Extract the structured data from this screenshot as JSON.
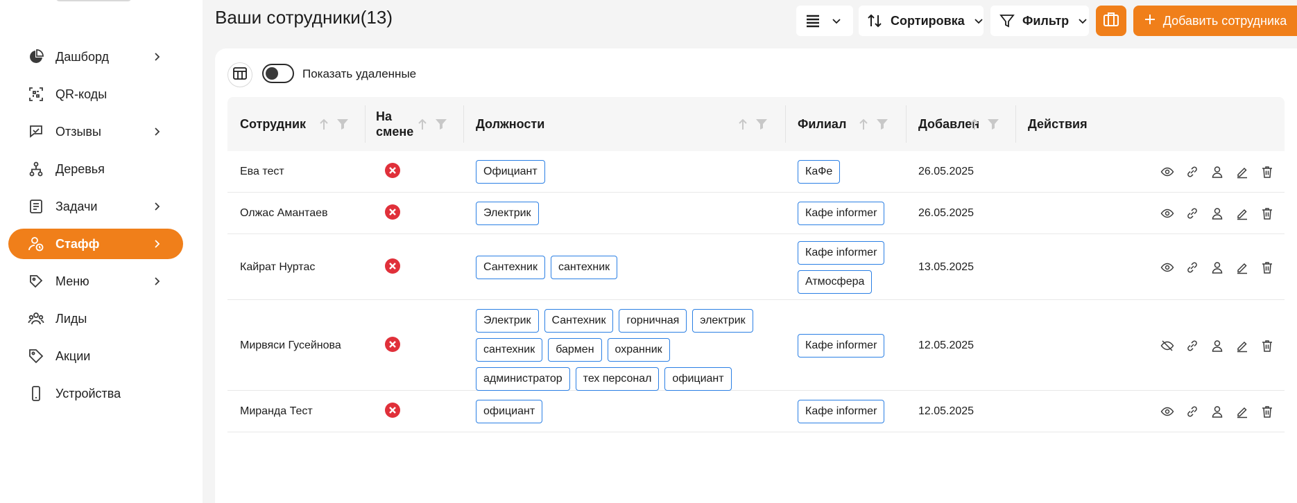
{
  "sidebar": {
    "items": [
      {
        "label": "Дашборд",
        "icon": "pie-chart-icon",
        "has_chevron": true,
        "active": false
      },
      {
        "label": "QR-коды",
        "icon": "qr-scan-icon",
        "has_chevron": false,
        "active": false
      },
      {
        "label": "Отзывы",
        "icon": "chat-check-icon",
        "has_chevron": true,
        "active": false
      },
      {
        "label": "Деревья",
        "icon": "tree-icon",
        "has_chevron": false,
        "active": false
      },
      {
        "label": "Задачи",
        "icon": "task-list-icon",
        "has_chevron": true,
        "active": false
      },
      {
        "label": "Стафф",
        "icon": "user-clock-icon",
        "has_chevron": true,
        "active": true
      },
      {
        "label": "Меню",
        "icon": "menu-tag-icon",
        "has_chevron": true,
        "active": false
      },
      {
        "label": "Лиды",
        "icon": "people-group-icon",
        "has_chevron": false,
        "active": false
      },
      {
        "label": "Акции",
        "icon": "price-tag-icon",
        "has_chevron": false,
        "active": false
      },
      {
        "label": "Устройства",
        "icon": "device-icon",
        "has_chevron": false,
        "active": false
      }
    ]
  },
  "header": {
    "title": "Ваши сотрудники(13)",
    "sort_label": "Сортировка",
    "filter_label": "Фильтр",
    "add_label": "Добавить сотрудника"
  },
  "controls": {
    "show_deleted_label": "Показать удаленные",
    "show_deleted": false
  },
  "table": {
    "headers": {
      "employee": "Сотрудник",
      "on_shift": "На смене",
      "positions": "Должности",
      "branch": "Филиал",
      "added": "Добавлен",
      "actions": "Действия"
    },
    "rows": [
      {
        "name": "Ева тест",
        "on_shift": false,
        "positions": [
          "Официант"
        ],
        "branches": [
          "КаФе"
        ],
        "added": "26.05.2025",
        "linked": true
      },
      {
        "name": "Олжас Амантаев",
        "on_shift": false,
        "positions": [
          "Электрик"
        ],
        "branches": [
          "Кафе informer"
        ],
        "added": "26.05.2025",
        "linked": true
      },
      {
        "name": "Кайрат Нуртас",
        "on_shift": false,
        "positions": [
          "Сантехник",
          "сантехник"
        ],
        "branches": [
          "Кафе informer",
          "Атмосфера"
        ],
        "added": "13.05.2025",
        "linked": true
      },
      {
        "name": "Мирвяси Гусейнова",
        "on_shift": false,
        "positions": [
          "Электрик",
          "Сантехник",
          "горничная",
          "электрик",
          "сантехник",
          "бармен",
          "охранник",
          "администратор",
          "тех персонал",
          "официант"
        ],
        "branches": [
          "Кафе informer"
        ],
        "added": "12.05.2025",
        "linked": false
      },
      {
        "name": "Миранда Тест",
        "on_shift": false,
        "positions": [
          "официант"
        ],
        "branches": [
          "Кафе informer"
        ],
        "added": "12.05.2025",
        "linked": true
      }
    ]
  },
  "colors": {
    "accent": "#f07f1a",
    "tag_border": "#2a7fe4",
    "status_off": "#e0303a"
  }
}
